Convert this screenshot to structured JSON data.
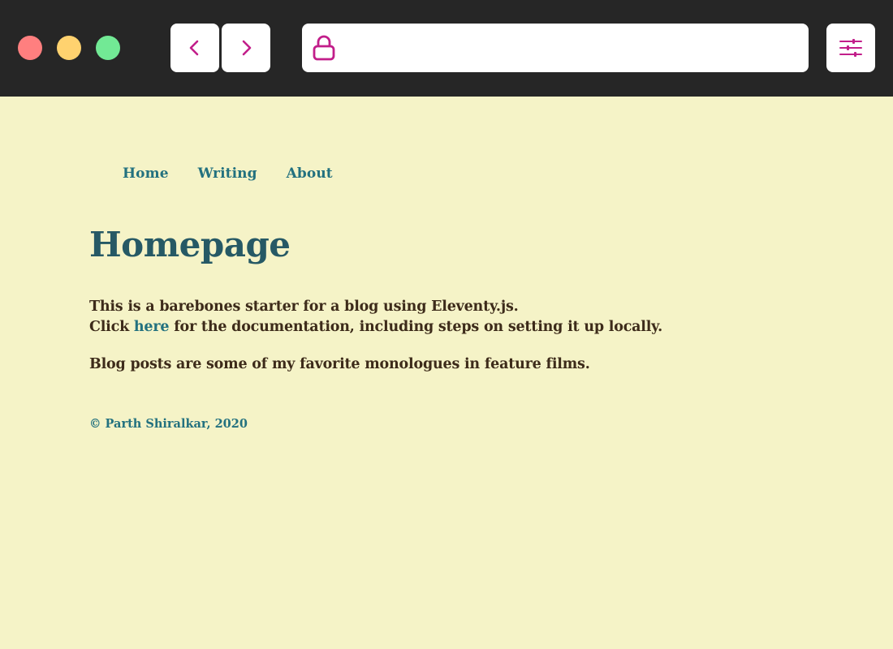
{
  "browser": {
    "url": "",
    "icons": {
      "back": "chevron-left-icon",
      "forward": "chevron-right-icon",
      "lock": "lock-icon",
      "settings": "sliders-icon"
    },
    "colors": {
      "chrome_bg": "#262626",
      "icon_accent": "#c21e8a",
      "close": "#ff7f7f",
      "minimize": "#ffd26f",
      "maximize": "#72e995"
    }
  },
  "site": {
    "nav": [
      {
        "label": "Home"
      },
      {
        "label": "Writing"
      },
      {
        "label": "About"
      }
    ],
    "title": "Homepage",
    "intro": {
      "line1": "This is a barebones starter for a blog using Eleventy.js.",
      "click_prefix": "Click ",
      "link_text": "here",
      "click_suffix": " for the documentation, including steps on setting it up locally."
    },
    "paragraph2": "Blog posts are some of my favorite monologues in feature films.",
    "footer": "© Parth Shiralkar, 2020",
    "colors": {
      "background": "#f5f3c7",
      "heading": "#265965",
      "link": "#23717f",
      "body_text": "#3d2b1a"
    }
  }
}
